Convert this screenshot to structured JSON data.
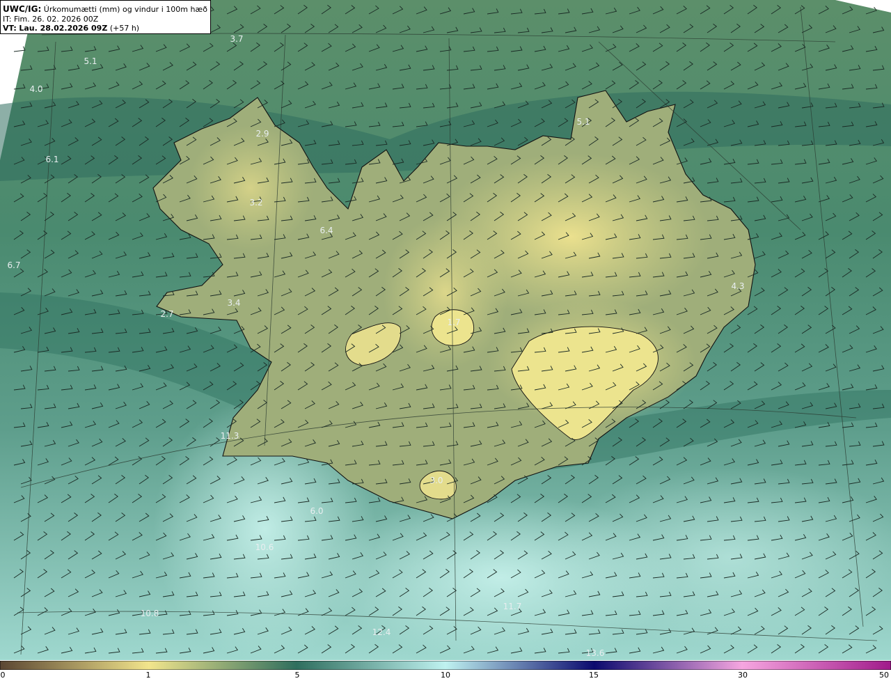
{
  "header": {
    "model": "UWC/IG:",
    "description": "Úrkomumætti (mm) og vindur i 100m hæð",
    "init_label": "IT:",
    "init_value": "Fim. 26. 02. 2026 00Z",
    "valid_label": "VT:",
    "valid_value": "Lau. 28.02.2026 09Z",
    "lead": "(+57 h)"
  },
  "colorbar": {
    "ticks": [
      "0",
      "1",
      "5",
      "10",
      "15",
      "30",
      "50"
    ],
    "colors": {
      "c0": "#5a4632",
      "c1": "#f2e58c",
      "c5": "#2f6e5e",
      "c10": "#bff2f0",
      "c15": "#0b0a6e",
      "c30": "#f6a6e0",
      "c50": "#a01a8a"
    }
  },
  "map_labels": [
    {
      "text": "3.7"
    },
    {
      "text": "5.1"
    },
    {
      "text": "4.0"
    },
    {
      "text": "2.9"
    },
    {
      "text": "6.1"
    },
    {
      "text": "3.2"
    },
    {
      "text": "6.4"
    },
    {
      "text": "6.7"
    },
    {
      "text": "3.4"
    },
    {
      "text": "2.7"
    },
    {
      "text": "5.1"
    },
    {
      "text": "4.3"
    },
    {
      "text": "1.7"
    },
    {
      "text": "3.0"
    },
    {
      "text": "6.0"
    },
    {
      "text": "10.6"
    },
    {
      "text": "11.7"
    },
    {
      "text": "10.8"
    },
    {
      "text": "12.4"
    },
    {
      "text": "13.6"
    },
    {
      "text": "11.3"
    }
  ],
  "colors": {
    "sea_green": "#4e8a70",
    "dark_teal": "#2f6e5e",
    "land_yellow": "#e8df8a",
    "light_cyan": "#a9e2d8",
    "coast": "#111111"
  }
}
